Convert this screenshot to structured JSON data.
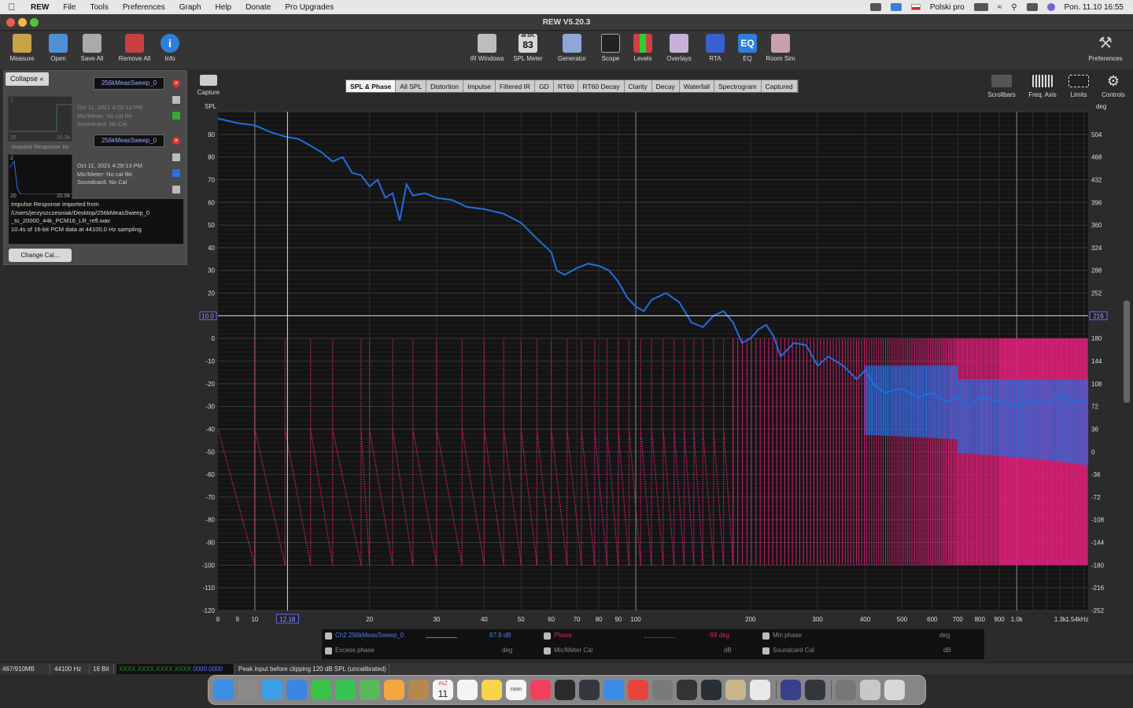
{
  "menubar": {
    "app": "REW",
    "items": [
      "File",
      "Tools",
      "Preferences",
      "Graph",
      "Help",
      "Donate",
      "Pro Upgrades"
    ],
    "input_source": "Polski pro",
    "clock": "Pon. 11.10  16:55"
  },
  "window": {
    "title": "REW V5.20.3"
  },
  "toolbar_left": [
    {
      "label": "Measure",
      "icon": "microphone-icon",
      "color": "#c9a24a"
    },
    {
      "label": "Open",
      "icon": "folder-icon",
      "color": "#4f8fd6"
    },
    {
      "label": "Save All",
      "icon": "save-icon",
      "color": "#aaaaaa"
    },
    {
      "label": "Remove All",
      "icon": "remove-icon",
      "color": "#c84040"
    },
    {
      "label": "Info",
      "icon": "info-icon",
      "color": "#2e7fd8"
    }
  ],
  "toolbar_center": [
    {
      "label": "IR Windows",
      "icon": "ir-windows-icon",
      "color": "#bdbdbd"
    },
    {
      "label": "SPL Meter",
      "icon": "spl-meter-icon",
      "color": "#d8d8d8",
      "readout": "83",
      "unit": "dB SPL"
    },
    {
      "label": "Generator",
      "icon": "generator-icon",
      "color": "#8fa7d6"
    },
    {
      "label": "Scope",
      "icon": "scope-icon",
      "color": "#222222"
    },
    {
      "label": "Levels",
      "icon": "levels-icon",
      "color": "#d04040"
    },
    {
      "label": "Overlays",
      "icon": "overlays-icon",
      "color": "#c9b0d9"
    },
    {
      "label": "RTA",
      "icon": "rta-icon",
      "color": "#3a5fd0"
    },
    {
      "label": "EQ",
      "icon": "eq-icon",
      "color": "#2e7fd8",
      "readout": "EQ"
    },
    {
      "label": "Room Sim",
      "icon": "room-sim-icon",
      "color": "#c8a0b0"
    }
  ],
  "toolbar_right": {
    "label": "Preferences",
    "icon": "preferences-icon"
  },
  "left_panel": {
    "collapse_label": "Collapse",
    "measurements": [
      {
        "index": "1",
        "name": "256kMeasSweep_0",
        "date": "Oct 11, 2021 4:28:13 PM",
        "mic": "Mic/Meter: No cal file",
        "soundcard": "Soundcard: No Cal",
        "range_low": "20",
        "range_high": "20.0k",
        "title": "Impulse Response Im"
      },
      {
        "index": "2",
        "name": "256kMeasSweep_0",
        "date": "Oct 11, 2021 4:28:13 PM",
        "mic": "Mic/Meter: No cal file",
        "soundcard": "Soundcard: No Cal",
        "range_low": "20",
        "range_high": "20.0k"
      }
    ],
    "notes": [
      "Impulse Response imported from",
      "/Users/jerzyszczesniak/Desktop/256kMeasSweep_0",
      "_to_20000_44k_PCM16_LR_refl.wav",
      "10.4s of 16-bit PCM data at 44100.0 Hz sampling"
    ],
    "change_cal_label": "Change Cal..."
  },
  "capture_label": "Capture",
  "graph_tabs": [
    "SPL & Phase",
    "All SPL",
    "Distortion",
    "Impulse",
    "Filtered IR",
    "GD",
    "RT60",
    "RT60 Decay",
    "Clarity",
    "Decay",
    "Waterfall",
    "Spectrogram",
    "Captured"
  ],
  "active_tab": "SPL & Phase",
  "graph_controls": [
    {
      "label": "Scrollbars",
      "icon": "scrollbars-icon"
    },
    {
      "label": "Freq. Axis",
      "icon": "freq-axis-icon"
    },
    {
      "label": "Limits",
      "icon": "limits-icon"
    },
    {
      "label": "Controls",
      "icon": "controls-gear-icon"
    }
  ],
  "chart_data": {
    "type": "line",
    "xscale": "log",
    "xlim": [
      8,
      1540
    ],
    "ylim_left": [
      -120,
      100
    ],
    "ylim_right": [
      -252,
      540
    ],
    "left_unit": "SPL",
    "right_unit": "deg",
    "grid": true,
    "x_ticks": [
      "8",
      "9",
      "10",
      "20",
      "30",
      "40",
      "50",
      "60",
      "70",
      "80",
      "90",
      "100",
      "200",
      "300",
      "400",
      "500",
      "600",
      "700",
      "800",
      "900",
      "1.0k",
      "1.3k",
      "1.54kHz"
    ],
    "x_tick_values": [
      8,
      9,
      10,
      20,
      30,
      40,
      50,
      60,
      70,
      80,
      90,
      100,
      200,
      300,
      400,
      500,
      600,
      700,
      800,
      900,
      1000,
      1300,
      1540
    ],
    "y_ticks_left": [
      90,
      80,
      70,
      60,
      50,
      40,
      30,
      20,
      0,
      -10,
      -20,
      -30,
      -40,
      -50,
      -60,
      -70,
      -80,
      -90,
      -100,
      -110,
      -120
    ],
    "y_ticks_right": [
      504,
      468,
      432,
      396,
      360,
      324,
      288,
      252,
      180,
      144,
      108,
      72,
      36,
      0,
      -36,
      -72,
      -108,
      -144,
      -180,
      -216,
      -252
    ],
    "cursor": {
      "x_label": "12.18",
      "x": 12.18,
      "y_left_label": "10.0",
      "y": 10.0,
      "y_right_label": "216"
    },
    "series": [
      {
        "name": "Ch2 256kMeasSweep_0",
        "color": "#1f6fe0",
        "points": [
          [
            8,
            97
          ],
          [
            9,
            95
          ],
          [
            10,
            94
          ],
          [
            11,
            91
          ],
          [
            12,
            89
          ],
          [
            13,
            88
          ],
          [
            14,
            85
          ],
          [
            15,
            82
          ],
          [
            16,
            78
          ],
          [
            17,
            80
          ],
          [
            18,
            73
          ],
          [
            19,
            72
          ],
          [
            20,
            67
          ],
          [
            21,
            70
          ],
          [
            22,
            62
          ],
          [
            23,
            64
          ],
          [
            24,
            52
          ],
          [
            25,
            68
          ],
          [
            26,
            63
          ],
          [
            28,
            64
          ],
          [
            30,
            62
          ],
          [
            33,
            61
          ],
          [
            36,
            58
          ],
          [
            40,
            57
          ],
          [
            45,
            55
          ],
          [
            50,
            51
          ],
          [
            55,
            44
          ],
          [
            60,
            38
          ],
          [
            62,
            30
          ],
          [
            65,
            28
          ],
          [
            70,
            31
          ],
          [
            75,
            33
          ],
          [
            80,
            32
          ],
          [
            85,
            30
          ],
          [
            90,
            25
          ],
          [
            95,
            18
          ],
          [
            100,
            14
          ],
          [
            105,
            12
          ],
          [
            110,
            17
          ],
          [
            120,
            20
          ],
          [
            130,
            16
          ],
          [
            140,
            7
          ],
          [
            150,
            5
          ],
          [
            160,
            10
          ],
          [
            170,
            12
          ],
          [
            180,
            7
          ],
          [
            190,
            -2
          ],
          [
            200,
            0
          ],
          [
            210,
            4
          ],
          [
            220,
            6
          ],
          [
            230,
            1
          ],
          [
            240,
            -8
          ],
          [
            250,
            -5
          ],
          [
            260,
            -2
          ],
          [
            280,
            -3
          ],
          [
            300,
            -12
          ],
          [
            320,
            -8
          ],
          [
            350,
            -12
          ],
          [
            380,
            -18
          ],
          [
            400,
            -14
          ],
          [
            420,
            -20
          ],
          [
            450,
            -24
          ],
          [
            500,
            -22
          ],
          [
            550,
            -26
          ],
          [
            600,
            -24
          ],
          [
            650,
            -28
          ],
          [
            700,
            -26
          ],
          [
            750,
            -30
          ],
          [
            800,
            -26
          ],
          [
            900,
            -28
          ],
          [
            1000,
            -30
          ],
          [
            1100,
            -27
          ],
          [
            1200,
            -29
          ],
          [
            1300,
            -25
          ],
          [
            1400,
            -28
          ],
          [
            1540,
            -27
          ]
        ]
      },
      {
        "name": "Phase",
        "color": "#e0207a",
        "style": "dotted",
        "wrap_frequencies": [
          10,
          12,
          14,
          16,
          19,
          20,
          23,
          26,
          30,
          35,
          40,
          45,
          50,
          55,
          60,
          66,
          72,
          78,
          84,
          90,
          96,
          103,
          110,
          118,
          126,
          134,
          142,
          150,
          160,
          170,
          180
        ]
      }
    ]
  },
  "legend": {
    "row1": [
      {
        "checked": true,
        "label": "Ch2 256kMeasSweep_0",
        "value": "87.9 dB",
        "color": "#4a7fe0"
      },
      {
        "checked": true,
        "label": "Phase",
        "value": "-99 deg",
        "color": "#e0207a"
      },
      {
        "checked": true,
        "label": "Min phase",
        "value": "deg",
        "color": "#777777"
      }
    ],
    "row2": [
      {
        "checked": true,
        "label": "Excess phase",
        "value": "deg",
        "color": "#777777"
      },
      {
        "checked": true,
        "label": "Mic/Meter Cal",
        "value": "dB",
        "color": "#777777"
      },
      {
        "checked": true,
        "label": "Soundcard Cal",
        "value": "dB",
        "color": "#777777"
      }
    ]
  },
  "statusbar": {
    "memory": "467/910MB",
    "rate": "44100 Hz",
    "bits": "16 Bit",
    "levels_left": "XXXX XXXX  XXXX XXXX",
    "levels_right": "0000 0000",
    "message": "Peak input before clipping 120 dB SPL (uncalibrated)"
  },
  "dock": {
    "calendar_month": "PAŹ",
    "calendar_day": "11",
    "apps": [
      {
        "icon": "finder-icon",
        "color": "#3b8fe6"
      },
      {
        "icon": "launchpad-icon",
        "color": "#8a8a8a"
      },
      {
        "icon": "safari-icon",
        "color": "#3aa0e8"
      },
      {
        "icon": "mail-icon",
        "color": "#3c86e3"
      },
      {
        "icon": "facetime-icon",
        "color": "#3cc04a"
      },
      {
        "icon": "messages-icon",
        "color": "#38c450"
      },
      {
        "icon": "maps-icon",
        "color": "#58b85a"
      },
      {
        "icon": "photos-icon",
        "color": "#f2a640"
      },
      {
        "icon": "contacts-icon",
        "color": "#b7884d"
      },
      {
        "icon": "calendar-icon",
        "color": "#f4f4f4"
      },
      {
        "icon": "reminders-icon",
        "color": "#f4f4f4"
      },
      {
        "icon": "notes-icon",
        "color": "#f7d44a"
      },
      {
        "icon": "roon-icon",
        "color": "#f4f4f4",
        "text": "roon"
      },
      {
        "icon": "music-icon",
        "color": "#f1405a"
      },
      {
        "icon": "disk-utility-icon",
        "color": "#2b2b2b"
      },
      {
        "icon": "instruments-icon",
        "color": "#33383f"
      },
      {
        "icon": "app-store-icon",
        "color": "#3a8ce8"
      },
      {
        "icon": "flashcard-icon",
        "color": "#e8443c"
      },
      {
        "icon": "system-preferences-icon",
        "color": "#7a7a7a"
      },
      {
        "icon": "audio-midi-icon",
        "color": "#333333"
      },
      {
        "icon": "airport-utility-icon",
        "color": "#2a2f36"
      },
      {
        "icon": "photo-booth-icon",
        "color": "#c8b58a"
      },
      {
        "icon": "acrobat-icon",
        "color": "#e8e8e8"
      },
      {
        "icon": "rew-icon",
        "color": "#3a3f8a"
      },
      {
        "icon": "instruments-icon-2",
        "color": "#33383f"
      },
      {
        "icon": "downloads-stack-icon",
        "color": "#777777"
      },
      {
        "icon": "documents-stack-icon",
        "color": "#c8c8c8"
      },
      {
        "icon": "trash-icon",
        "color": "#d8d8d8"
      }
    ]
  }
}
